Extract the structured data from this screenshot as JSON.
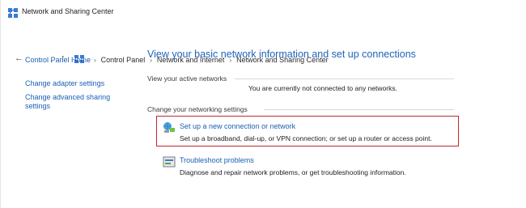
{
  "window": {
    "title": "Network and Sharing Center"
  },
  "address": {
    "breadcrumbs": [
      "Control Panel",
      "Network and Internet",
      "Network and Sharing Center"
    ]
  },
  "sidebar": {
    "items": [
      {
        "label": "Control Panel Home"
      },
      {
        "label": "Change adapter settings"
      },
      {
        "label": "Change advanced sharing settings"
      }
    ]
  },
  "main": {
    "title": "View your basic network information and set up connections",
    "active_networks_label": "View your active networks",
    "active_networks_status": "You are currently not connected to any networks.",
    "change_settings_label": "Change your networking settings",
    "tasks": [
      {
        "link": "Set up a new connection or network",
        "description": "Set up a broadband, dial-up, or VPN connection; or set up a router or access point.",
        "icon": "network-setup-icon"
      },
      {
        "link": "Troubleshoot problems",
        "description": "Diagnose and repair network problems, or get troubleshooting information.",
        "icon": "troubleshoot-icon"
      }
    ]
  },
  "colors": {
    "link": "#1a5fb4",
    "title": "#1e63b8",
    "highlight_border": "#c0282d"
  }
}
